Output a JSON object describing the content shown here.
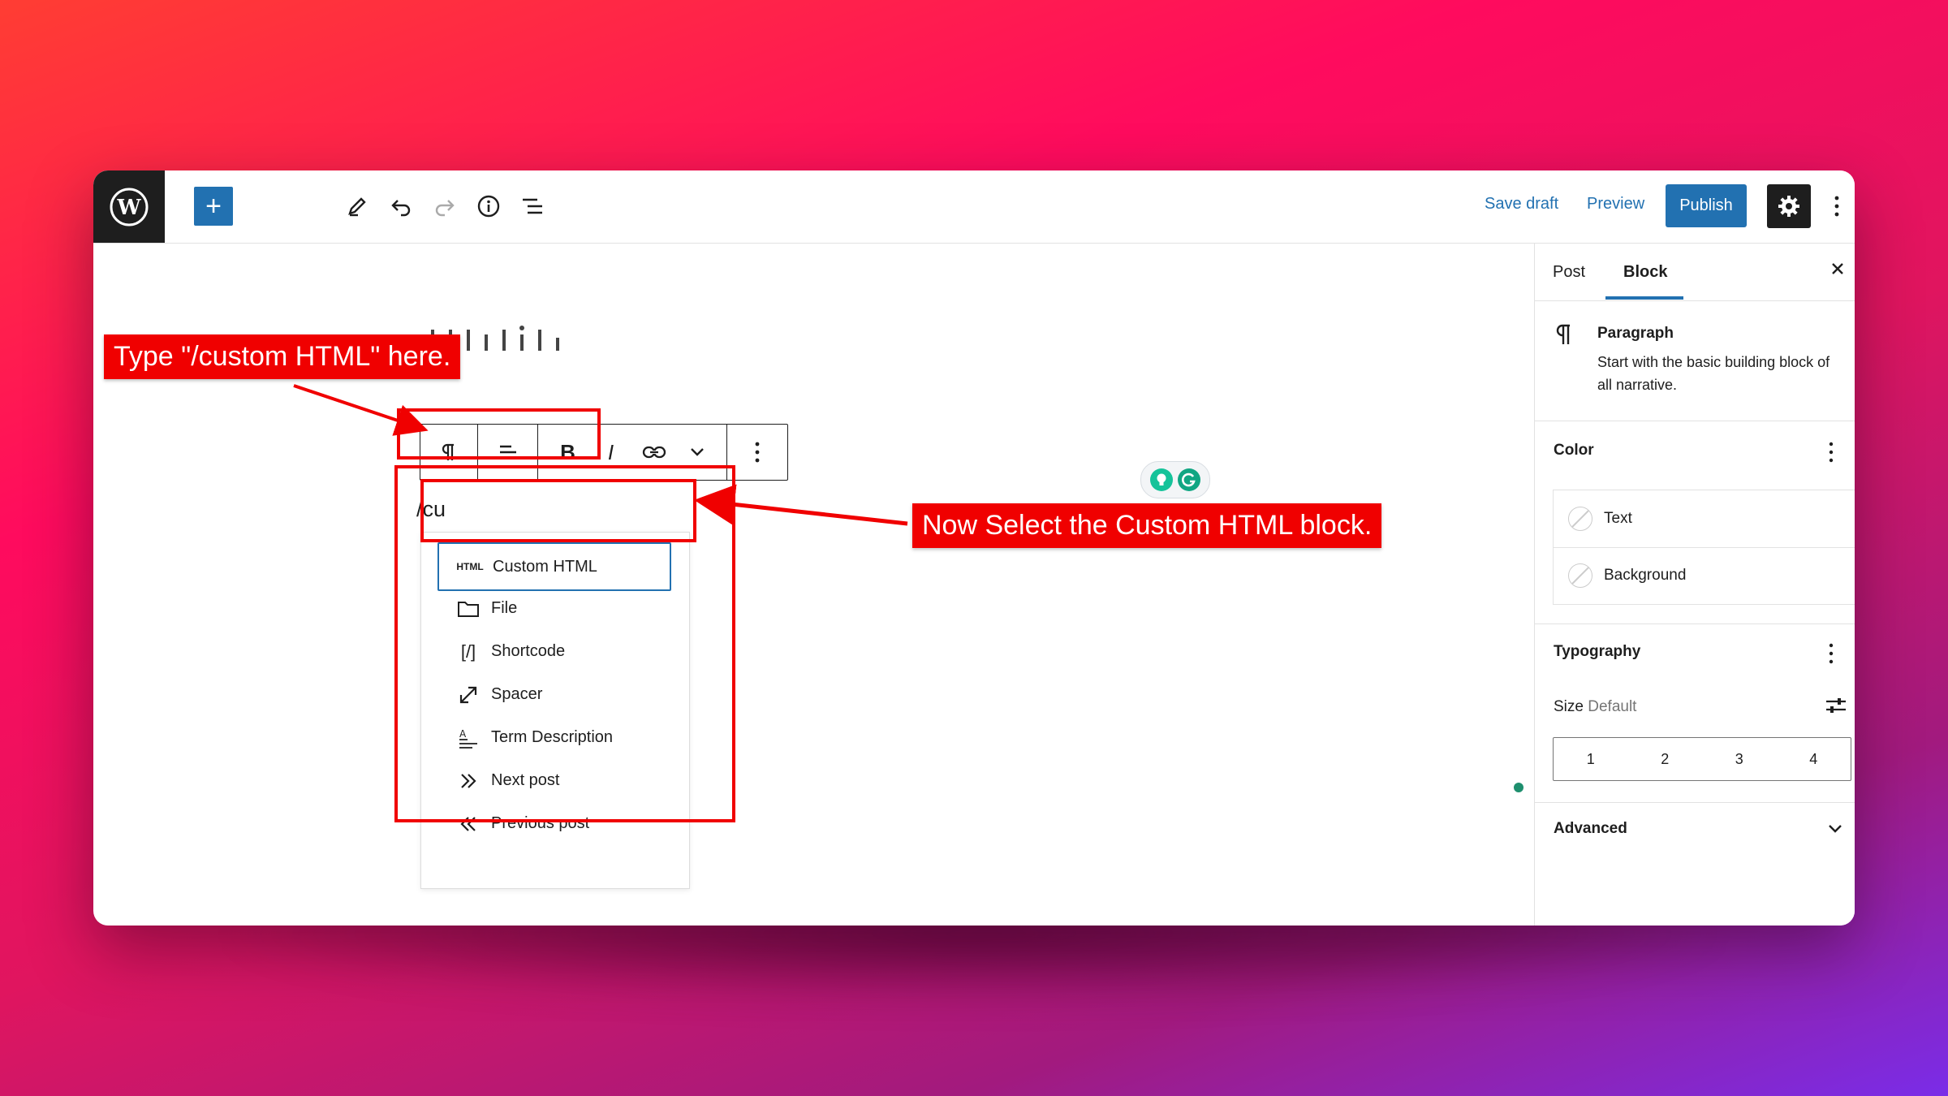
{
  "toolbar": {
    "add_symbol": "+",
    "save_draft": "Save draft",
    "preview": "Preview",
    "publish": "Publish"
  },
  "editor": {
    "typed_text": "/cu",
    "block_toolbar": {
      "bold": "B",
      "italic": "I"
    }
  },
  "inserter": {
    "items": [
      {
        "label": "Custom HTML",
        "icon": "html-icon",
        "icon_text": "HTML"
      },
      {
        "label": "File",
        "icon": "folder-icon"
      },
      {
        "label": "Shortcode",
        "icon": "shortcode-icon",
        "icon_text": "[/]"
      },
      {
        "label": "Spacer",
        "icon": "resize-icon"
      },
      {
        "label": "Term Description",
        "icon": "term-description-icon"
      },
      {
        "label": "Next post",
        "icon": "chevrons-right-icon",
        "icon_text": "»"
      },
      {
        "label": "Previous post",
        "icon": "chevrons-left-icon",
        "icon_text": "«"
      }
    ]
  },
  "sidebar": {
    "tabs": [
      "Post",
      "Block"
    ],
    "active_tab": "Block",
    "block": {
      "title": "Paragraph",
      "description": "Start with the basic building block of all narrative."
    },
    "color": {
      "title": "Color",
      "items": [
        "Text",
        "Background"
      ]
    },
    "typography": {
      "title": "Typography",
      "size_label": "Size",
      "size_value": "Default",
      "sizes": [
        "1",
        "2",
        "3",
        "4"
      ]
    },
    "advanced": {
      "title": "Advanced"
    }
  },
  "annotations": {
    "callout_type": "Type \"/custom HTML\" here.",
    "callout_select": "Now Select the Custom HTML block."
  },
  "colors": {
    "accent": "#2271b1",
    "annotation_red": "#f00000",
    "dark": "#1e1e1e"
  }
}
